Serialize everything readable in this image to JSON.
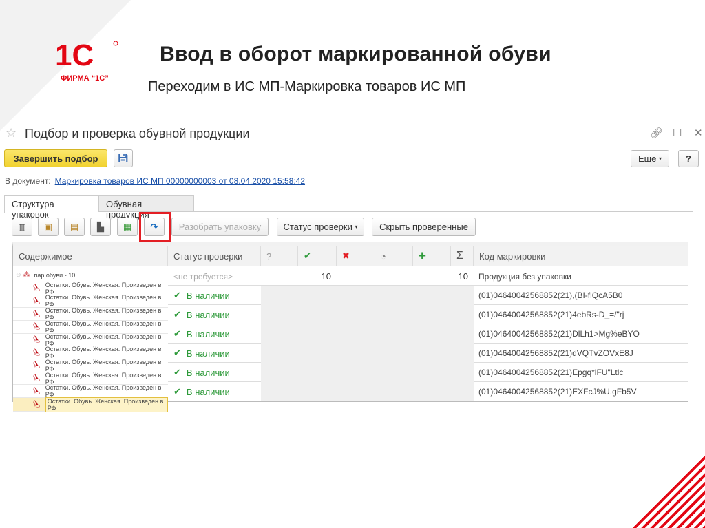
{
  "slide": {
    "title": "Ввод в оборот маркированной обуви",
    "subtitle": "Переходим в ИС МП-Маркировка товаров ИС МП",
    "logo_text": "ФИРМА “1С”"
  },
  "window": {
    "title": "Подбор и проверка обувной продукции",
    "finish_button": "Завершить подбор",
    "more_button": "Еще",
    "help_button": "?",
    "doc_label": "В документ:",
    "doc_link": "Маркировка товаров ИС МП 00000000003 от 08.04.2020 15:58:42"
  },
  "tabs": [
    {
      "label": "Структура упаковок"
    },
    {
      "label": "Обувная продукция"
    }
  ],
  "toolbar": {
    "unpack": "Разобрать упаковку",
    "status": "Статус проверки",
    "hide_checked": "Скрыть проверенные"
  },
  "columns": {
    "content": "Содержимое",
    "status": "Статус проверки",
    "unknown": "?",
    "ok": "✔",
    "err": "✖",
    "partial": "◔",
    "plus": "✚",
    "sum": "Σ",
    "code": "Код маркировки"
  },
  "tree": {
    "group": "пар обуви - 10",
    "item": "Остатки. Обувь. Женская. Произведен в РФ",
    "count": 10
  },
  "first_row": {
    "status": "<не требуется>",
    "ok_count": "10",
    "sum": "10",
    "code": "Продукция без упаковки"
  },
  "rows": [
    {
      "status": "В наличии",
      "code": "(01)04640042568852(21),(BI-flQcA5B0"
    },
    {
      "status": "В наличии",
      "code": "(01)04640042568852(21)4ebRs-D_=/\"rj"
    },
    {
      "status": "В наличии",
      "code": "(01)04640042568852(21)DlLh1>Mg%eBYO"
    },
    {
      "status": "В наличии",
      "code": "(01)04640042568852(21)dVQTvZOVxE8J"
    },
    {
      "status": "В наличии",
      "code": "(01)04640042568852(21)Epgq*lFU\"Ltlc"
    },
    {
      "status": "В наличии",
      "code": "(01)04640042568852(21)EXFcJ%U.gFb5V"
    }
  ]
}
